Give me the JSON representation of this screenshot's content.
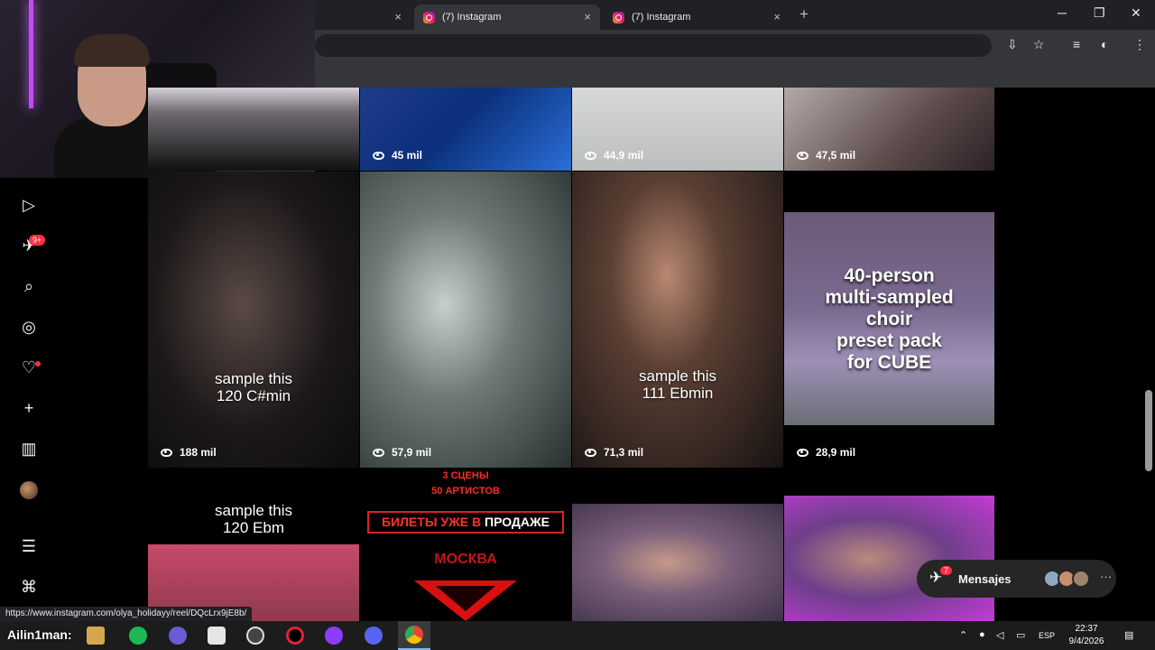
{
  "browser": {
    "tabs": [
      {
        "label": "(7) Instagram"
      },
      {
        "label": "(7) Instagram"
      }
    ],
    "new_tab": "+",
    "close": "×",
    "window": {
      "minimize": "─",
      "restore": "❐",
      "close": "✕"
    }
  },
  "sidebar": {
    "notif_badge": "9+"
  },
  "tiles": [
    {
      "views": "45 mil"
    },
    {
      "views": "44,9 mil"
    },
    {
      "views": "47,5 mil"
    },
    {
      "views": "188 mil",
      "caption": [
        "sample this",
        "120 C#min"
      ]
    },
    {
      "views": "57,9 mil"
    },
    {
      "views": "71,3 mil",
      "caption": [
        "sample this",
        "111 Ebmin"
      ]
    },
    {
      "views": "28,9 mil",
      "caption": [
        "40-person",
        "multi-sampled",
        "choir",
        "preset pack",
        "for CUBE"
      ]
    },
    {
      "caption": [
        "sample this",
        "120 Ebm"
      ]
    },
    {
      "ru_top": [
        "3 СЦЕНЫ",
        "50 АРТИСТОВ"
      ],
      "banner_a": "БИЛЕТЫ УЖЕ В ",
      "banner_b": "ПРОДАЖЕ",
      "city": "МОСКВА"
    }
  ],
  "messages": {
    "label": "Mensajes",
    "badge": "7",
    "more": "···"
  },
  "status_url": "https://www.instagram.com/olya_holidayy/reel/DQcLrx9jE8b/",
  "taskbar": {
    "overlay_name": "Ailin1man:",
    "lang": "ESP",
    "time": "22:37",
    "date": "9/4/2026"
  },
  "colors": {
    "accent_red": "#ff3040",
    "ig_bg": "#000000",
    "chrome_bg": "#35363a"
  }
}
